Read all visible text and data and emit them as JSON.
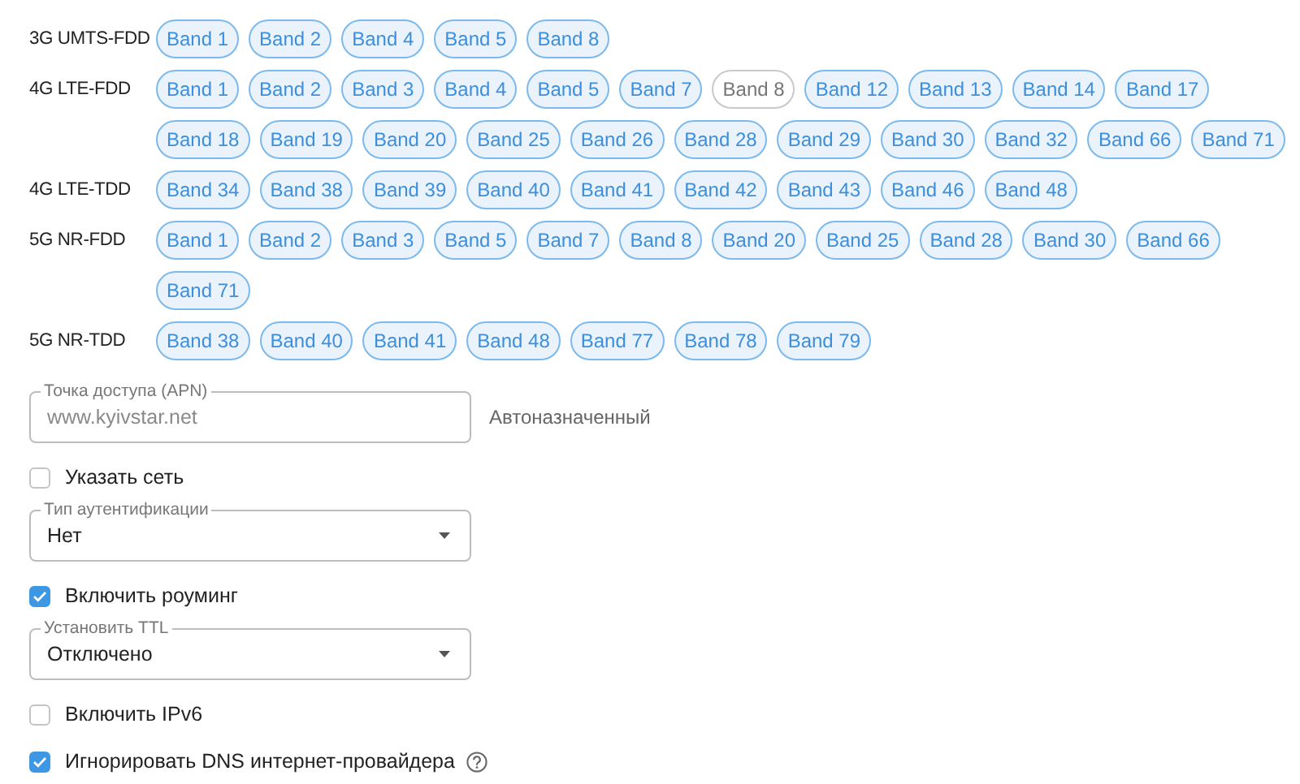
{
  "band_groups": [
    {
      "label": "3G UMTS-FDD",
      "bands": [
        {
          "label": "Band 1",
          "selected": true
        },
        {
          "label": "Band 2",
          "selected": true
        },
        {
          "label": "Band 4",
          "selected": true
        },
        {
          "label": "Band 5",
          "selected": true
        },
        {
          "label": "Band 8",
          "selected": true
        }
      ]
    },
    {
      "label": "4G LTE-FDD",
      "bands": [
        {
          "label": "Band 1",
          "selected": true
        },
        {
          "label": "Band 2",
          "selected": true
        },
        {
          "label": "Band 3",
          "selected": true
        },
        {
          "label": "Band 4",
          "selected": true
        },
        {
          "label": "Band 5",
          "selected": true
        },
        {
          "label": "Band 7",
          "selected": true
        },
        {
          "label": "Band 8",
          "selected": false
        },
        {
          "label": "Band 12",
          "selected": true
        },
        {
          "label": "Band 13",
          "selected": true
        },
        {
          "label": "Band 14",
          "selected": true
        },
        {
          "label": "Band 17",
          "selected": true
        },
        {
          "label": "Band 18",
          "selected": true
        },
        {
          "label": "Band 19",
          "selected": true
        },
        {
          "label": "Band 20",
          "selected": true
        },
        {
          "label": "Band 25",
          "selected": true
        },
        {
          "label": "Band 26",
          "selected": true
        },
        {
          "label": "Band 28",
          "selected": true
        },
        {
          "label": "Band 29",
          "selected": true
        },
        {
          "label": "Band 30",
          "selected": true
        },
        {
          "label": "Band 32",
          "selected": true
        },
        {
          "label": "Band 66",
          "selected": true
        },
        {
          "label": "Band 71",
          "selected": true
        }
      ]
    },
    {
      "label": "4G LTE-TDD",
      "bands": [
        {
          "label": "Band 34",
          "selected": true
        },
        {
          "label": "Band 38",
          "selected": true
        },
        {
          "label": "Band 39",
          "selected": true
        },
        {
          "label": "Band 40",
          "selected": true
        },
        {
          "label": "Band 41",
          "selected": true
        },
        {
          "label": "Band 42",
          "selected": true
        },
        {
          "label": "Band 43",
          "selected": true
        },
        {
          "label": "Band 46",
          "selected": true
        },
        {
          "label": "Band 48",
          "selected": true
        }
      ]
    },
    {
      "label": "5G NR-FDD",
      "bands": [
        {
          "label": "Band 1",
          "selected": true
        },
        {
          "label": "Band 2",
          "selected": true
        },
        {
          "label": "Band 3",
          "selected": true
        },
        {
          "label": "Band 5",
          "selected": true
        },
        {
          "label": "Band 7",
          "selected": true
        },
        {
          "label": "Band 8",
          "selected": true
        },
        {
          "label": "Band 20",
          "selected": true
        },
        {
          "label": "Band 25",
          "selected": true
        },
        {
          "label": "Band 28",
          "selected": true
        },
        {
          "label": "Band 30",
          "selected": true
        },
        {
          "label": "Band 66",
          "selected": true
        },
        {
          "label": "Band 71",
          "selected": true
        }
      ]
    },
    {
      "label": "5G NR-TDD",
      "bands": [
        {
          "label": "Band 38",
          "selected": true
        },
        {
          "label": "Band 40",
          "selected": true
        },
        {
          "label": "Band 41",
          "selected": true
        },
        {
          "label": "Band 48",
          "selected": true
        },
        {
          "label": "Band 77",
          "selected": true
        },
        {
          "label": "Band 78",
          "selected": true
        },
        {
          "label": "Band 79",
          "selected": true
        }
      ]
    }
  ],
  "settings": [
    {
      "kind": "text",
      "label": "Точка доступа (APN)",
      "placeholder": "www.kyivstar.net",
      "note": "Автоназначенный"
    },
    {
      "kind": "checkbox",
      "label": "Указать сеть",
      "checked": false,
      "help": false
    },
    {
      "kind": "select",
      "label": "Тип аутентификации",
      "value": "Нет"
    },
    {
      "kind": "checkbox",
      "label": "Включить роуминг",
      "checked": true,
      "help": false
    },
    {
      "kind": "select",
      "label": "Установить TTL",
      "value": "Отключено"
    },
    {
      "kind": "checkbox",
      "label": "Включить IPv6",
      "checked": false,
      "help": false
    },
    {
      "kind": "checkbox",
      "label": "Игнорировать DNS интернет-провайдера",
      "checked": true,
      "help": true
    }
  ]
}
